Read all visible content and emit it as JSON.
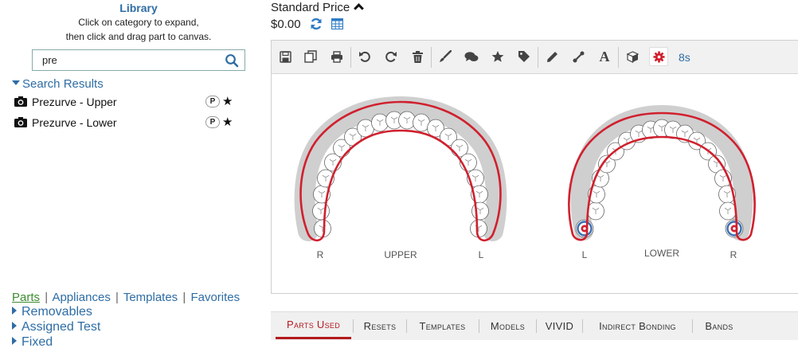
{
  "library": {
    "title": "Library",
    "instruction_line1": "Click on category to expand,",
    "instruction_line2": "then click and drag part to canvas.",
    "search": {
      "value": "pre",
      "placeholder": ""
    },
    "search_results_label": "Search Results",
    "results": [
      {
        "label": "Prezurve - Upper",
        "badge": "P"
      },
      {
        "label": "Prezurve - Lower",
        "badge": "P"
      }
    ],
    "bottom_links": [
      "Parts",
      "Appliances",
      "Templates",
      "Favorites"
    ],
    "active_link": "Parts",
    "link_separator": "|",
    "categories": [
      "Removables",
      "Assigned Test",
      "Fixed"
    ]
  },
  "pricing": {
    "label": "Standard Price",
    "value": "$0.00"
  },
  "toolbar": {
    "timer": "8s",
    "buttons": [
      "save-icon",
      "copy-icon",
      "print-icon",
      "undo-icon",
      "redo-icon",
      "trash-icon",
      "brush-icon",
      "comment-icon",
      "star-icon",
      "tag-icon",
      "pencil-icon",
      "connector-icon",
      "text-icon",
      "cube-icon",
      "gear-icon"
    ]
  },
  "canvas": {
    "upper": {
      "label": "UPPER",
      "left": "R",
      "right": "L"
    },
    "lower": {
      "label": "LOWER",
      "left": "L",
      "right": "R"
    }
  },
  "tabs": [
    {
      "label": "Parts Used",
      "active": true
    },
    {
      "label": "Resets",
      "active": false
    },
    {
      "label": "Templates",
      "active": false
    },
    {
      "label": "Models",
      "active": false
    },
    {
      "label": "VIVID",
      "active": false
    },
    {
      "label": "Indirect Bonding",
      "active": false
    },
    {
      "label": "Bands",
      "active": false
    }
  ],
  "colors": {
    "accent_blue": "#2e6da4",
    "active_red": "#b3191d",
    "appliance_red": "#d0202e",
    "link_green": "#3c8d2f"
  }
}
